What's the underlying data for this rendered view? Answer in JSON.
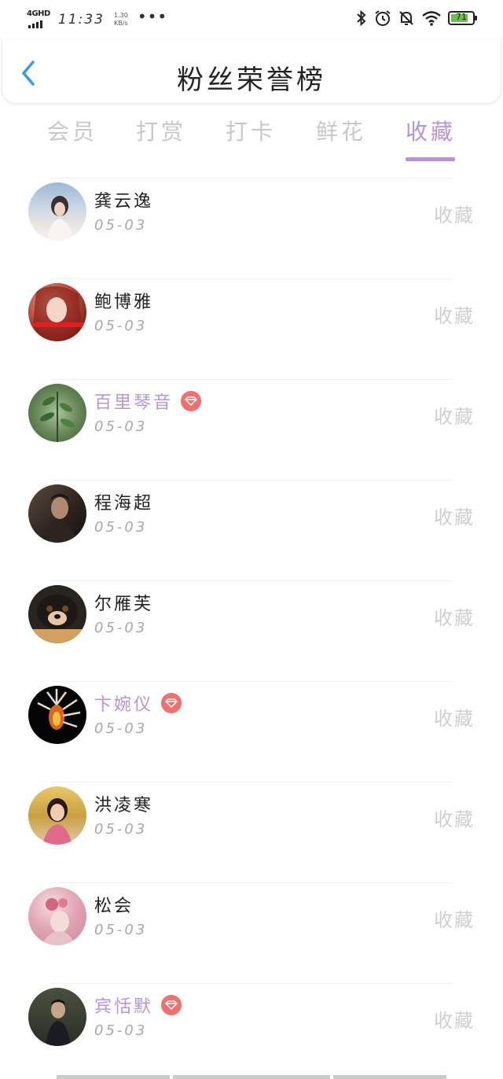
{
  "status_bar": {
    "network": "4GHD",
    "time": "11:33",
    "speed_value": "1.30",
    "speed_unit": "KB/s",
    "more": "•••",
    "battery_level": "71",
    "icons": [
      "bluetooth-icon",
      "alarm-icon",
      "mute-icon",
      "wifi-icon",
      "battery-icon"
    ]
  },
  "header": {
    "title": "粉丝荣誉榜",
    "back_icon": "chevron-left-icon",
    "back_color": "#3a9ae8"
  },
  "tabs": [
    {
      "label": "会员",
      "active": false
    },
    {
      "label": "打赏",
      "active": false
    },
    {
      "label": "打卡",
      "active": false
    },
    {
      "label": "鲜花",
      "active": false
    },
    {
      "label": "收藏",
      "active": true
    }
  ],
  "colors": {
    "accent": "#b694d8",
    "vip_badge": "#f06f6f",
    "inactive": "#c8c8c8",
    "date": "#a8a8a8"
  },
  "fans": [
    {
      "name": "龚云逸",
      "date": "05-03",
      "action": "收藏",
      "vip": false
    },
    {
      "name": "鲍博雅",
      "date": "05-03",
      "action": "收藏",
      "vip": false
    },
    {
      "name": "百里琴音",
      "date": "05-03",
      "action": "收藏",
      "vip": true
    },
    {
      "name": "程海超",
      "date": "05-03",
      "action": "收藏",
      "vip": false
    },
    {
      "name": "尔雁芙",
      "date": "05-03",
      "action": "收藏",
      "vip": false
    },
    {
      "name": "卞婉仪",
      "date": "05-03",
      "action": "收藏",
      "vip": true
    },
    {
      "name": "洪凌寒",
      "date": "05-03",
      "action": "收藏",
      "vip": false
    },
    {
      "name": "松会",
      "date": "05-03",
      "action": "收藏",
      "vip": false
    },
    {
      "name": "宾恬默",
      "date": "05-03",
      "action": "收藏",
      "vip": true
    }
  ]
}
